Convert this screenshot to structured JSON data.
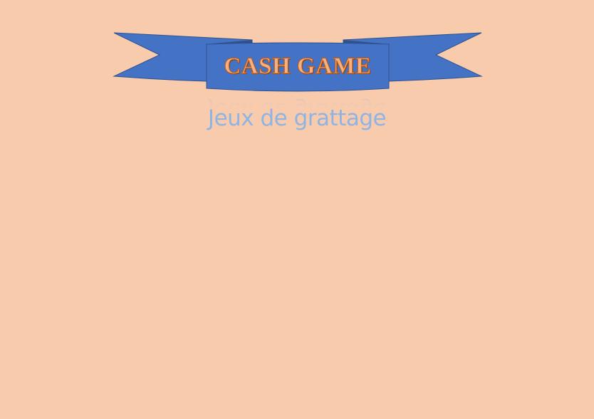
{
  "banner": {
    "title": "CASH GAME",
    "ribbon_color": "#4472c4",
    "ribbon_shadow_color": "#2f528f",
    "title_fill_color": "#f4b183",
    "title_outline_color": "#c55a11"
  },
  "subtitle": {
    "text": "Jeux de grattage",
    "color": "#8fb4e3"
  },
  "page": {
    "background_color": "#f8cbad"
  }
}
